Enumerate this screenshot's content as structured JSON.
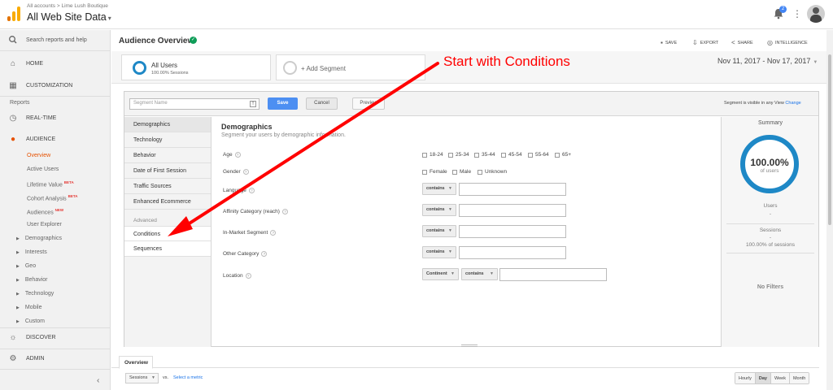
{
  "header": {
    "breadcrumb": "All accounts > Lime Lush Boutique",
    "account": "All Web Site Data",
    "notification_count": "2",
    "colors": {
      "logo": [
        "#f9ab00",
        "#e37400",
        "#e37400"
      ],
      "accent": "#1e88c6"
    }
  },
  "sidebar": {
    "search": "Search reports and help",
    "home": "HOME",
    "customization": "CUSTOMIZATION",
    "reports": "Reports",
    "realtime": "REAL-TIME",
    "audience": "AUDIENCE",
    "audience_items": [
      {
        "label": "Overview",
        "tag": ""
      },
      {
        "label": "Active Users",
        "tag": ""
      },
      {
        "label": "Lifetime Value",
        "tag": "BETA"
      },
      {
        "label": "Cohort Analysis",
        "tag": "BETA"
      },
      {
        "label": "Audiences",
        "tag": "NEW"
      },
      {
        "label": "User Explorer",
        "tag": ""
      }
    ],
    "expandables": [
      "Demographics",
      "Interests",
      "Geo",
      "Behavior",
      "Technology",
      "Mobile",
      "Custom"
    ],
    "discover": "DISCOVER",
    "admin": "ADMIN"
  },
  "main": {
    "title": "Audience Overview",
    "toolbar": {
      "save": "SAVE",
      "export": "EXPORT",
      "share": "SHARE",
      "intelligence": "INTELLIGENCE"
    },
    "segment": {
      "name": "All Users",
      "pct": "100.00% Sessions",
      "add": "+ Add Segment"
    },
    "date_range": "Nov 11, 2017 - Nov 17, 2017"
  },
  "editor": {
    "name_placeholder": "Segment Name",
    "save": "Save",
    "cancel": "Cancel",
    "preview": "Preview",
    "visibility": "Segment is visible in any View",
    "change": "Change",
    "tabs": [
      "Demographics",
      "Technology",
      "Behavior",
      "Date of First Session",
      "Traffic Sources",
      "Enhanced Ecommerce"
    ],
    "advanced": "Advanced",
    "adv_tabs": [
      "Conditions",
      "Sequences"
    ],
    "section_title": "Demographics",
    "section_sub": "Segment your users by demographic information.",
    "labels": {
      "age": "Age",
      "gender": "Gender",
      "language": "Language",
      "affinity": "Affinity Category (reach)",
      "inmarket": "In-Market Segment",
      "other": "Other Category",
      "location": "Location"
    },
    "ages": [
      "18-24",
      "25-34",
      "35-44",
      "45-54",
      "55-64",
      "65+"
    ],
    "genders": [
      "Female",
      "Male",
      "Unknown"
    ],
    "contains": "contains",
    "continent": "Continent",
    "summary": {
      "title": "Summary",
      "pct": "100.00%",
      "of": "of users",
      "users_label": "Users",
      "users_value": "-",
      "sessions_label": "Sessions",
      "sessions_value": "-",
      "sessions_pct": "100.00% of sessions",
      "no_filters": "No Filters"
    }
  },
  "overview": {
    "tab": "Overview",
    "metric": "Sessions",
    "vs": "vs.",
    "select_metric": "Select a metric",
    "granularity": [
      "Hourly",
      "Day",
      "Week",
      "Month"
    ]
  },
  "annotation": {
    "text": "Start with Conditions",
    "color": "#ff0000"
  }
}
